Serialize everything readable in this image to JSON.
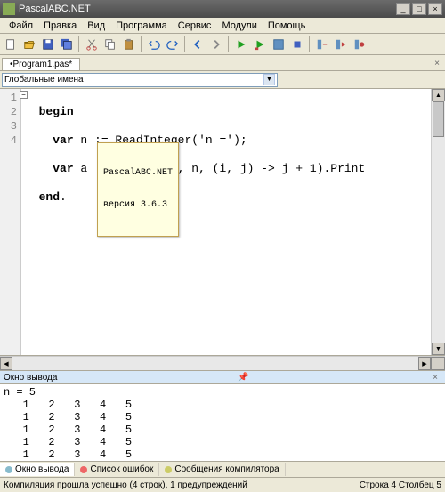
{
  "titlebar": {
    "title": "PascalABC.NET"
  },
  "menu": {
    "file": "Файл",
    "edit": "Правка",
    "view": "Вид",
    "program": "Программа",
    "service": "Сервис",
    "modules": "Модули",
    "help": "Помощь"
  },
  "tab": {
    "name": "•Program1.pas*"
  },
  "combo": {
    "label": "Глобальные имена"
  },
  "code": {
    "lines": [
      "1",
      "2",
      "3",
      "4"
    ],
    "l1_kw": "begin",
    "l2_kw": "var",
    "l2_rest": " n := ReadInteger(",
    "l2_str": "'n ='",
    "l2_end": ");",
    "l3_kw": "var",
    "l3_rest": " a := MatrGen(n, n, (i, j) -> j + 1).Print",
    "l4_kw": "end",
    "l4_dot": "."
  },
  "tooltip": {
    "line1": "PascalABC.NET",
    "line2": "версия 3.6.3"
  },
  "output_panel": {
    "title": "Окно вывода"
  },
  "output_text": "n = 5\n   1   2   3   4   5\n   1   2   3   4   5\n   1   2   3   4   5\n   1   2   3   4   5\n   1   2   3   4   5",
  "btabs": {
    "out": "Окно вывода",
    "err": "Список ошибок",
    "msg": "Сообщения компилятора"
  },
  "status": {
    "left": "Компиляция прошла успешно (4 строк), 1 предупреждений",
    "right": "Строка  4 Столбец  5"
  }
}
